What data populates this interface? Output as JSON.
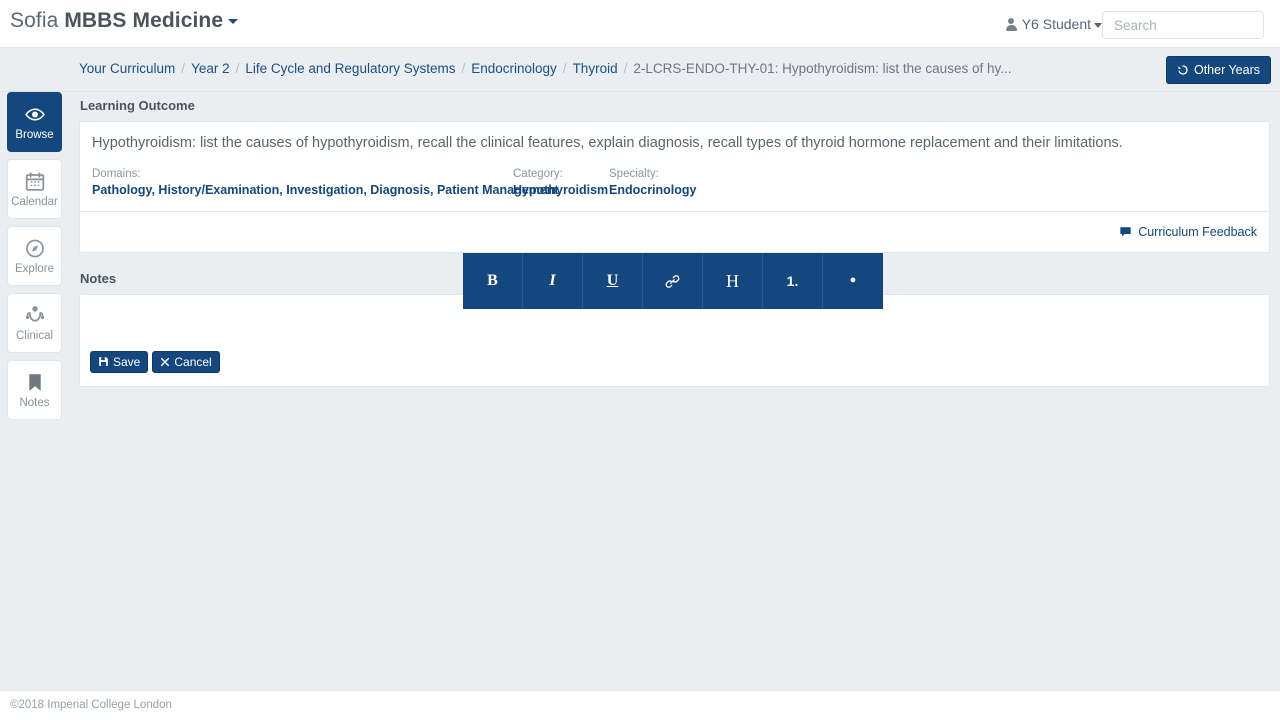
{
  "header": {
    "brand_prefix": "Sofia",
    "brand_name": "MBBS Medicine",
    "user_label": "Y6 Student",
    "search_placeholder": "Search",
    "search_value": ""
  },
  "breadcrumb": {
    "items": [
      "Your Curriculum",
      "Year 2",
      "Life Cycle and Regulatory Systems",
      "Endocrinology",
      "Thyroid"
    ],
    "current": "2-LCRS-ENDO-THY-01: Hypothyroidism: list the causes of hy...",
    "separator": "/"
  },
  "other_years_button": {
    "label": "Other Years",
    "icon": "history-icon"
  },
  "sidebar": {
    "items": [
      {
        "label": "Browse",
        "icon": "eye-icon",
        "active": true
      },
      {
        "label": "Calendar",
        "icon": "calendar-icon",
        "active": false
      },
      {
        "label": "Explore",
        "icon": "compass-icon",
        "active": false
      },
      {
        "label": "Clinical",
        "icon": "stethoscope-icon",
        "active": false
      },
      {
        "label": "Notes",
        "icon": "bookmark-icon",
        "active": false
      }
    ]
  },
  "learning_outcome": {
    "panel_title": "Learning Outcome",
    "text": "Hypothyroidism: list the causes of hypothyroidism, recall the clinical features, explain diagnosis, recall types of thyroid hormone replacement and their limitations.",
    "domains_label": "Domains:",
    "domains_value": "Pathology, History/Examination, Investigation, Diagnosis, Patient Management",
    "category_label": "Category:",
    "category_value": "Hypothyroidism",
    "specialty_label": "Specialty:",
    "specialty_value": "Endocrinology",
    "feedback_link": "Curriculum Feedback",
    "feedback_icon": "comment-icon"
  },
  "notes": {
    "panel_title": "Notes",
    "body_value": "",
    "save_label": "Save",
    "save_icon": "floppy-disk-icon",
    "cancel_label": "Cancel",
    "cancel_icon": "times-icon"
  },
  "editor_toolbar": {
    "buttons": [
      {
        "label": "B",
        "name": "bold"
      },
      {
        "label": "I",
        "name": "italic"
      },
      {
        "label": "U",
        "name": "underline"
      },
      {
        "label": "",
        "name": "link"
      },
      {
        "label": "H",
        "name": "heading"
      },
      {
        "label": "1.",
        "name": "ordered-list"
      },
      {
        "label": "•",
        "name": "unordered-list"
      }
    ]
  },
  "footer": {
    "copyright": "©2018 Imperial College London"
  },
  "colors": {
    "navy": "#14477d",
    "page_bg": "#eaeef1",
    "link": "#1b4f82"
  }
}
